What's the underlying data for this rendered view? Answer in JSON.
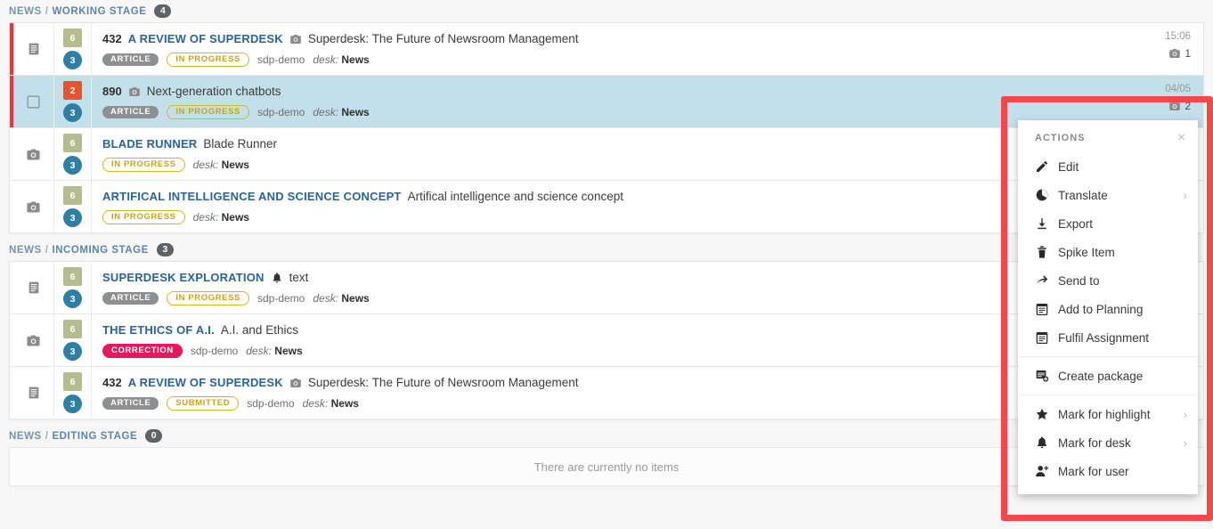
{
  "stages": [
    {
      "desk": "NEWS",
      "separator": "/",
      "name": "WORKING STAGE",
      "count": "4",
      "empty_text": "",
      "items": [
        {
          "type_icon": "document-icon",
          "priority_bar": true,
          "selected": false,
          "checkbox": false,
          "urgency": "6",
          "urgency_color": "#b5bd8f",
          "priority": "3",
          "priority_color": "#2f7ea3",
          "item_number": "432",
          "slugline": "A REVIEW OF SUPERDESK",
          "has_camera_icon": true,
          "has_bell_icon": false,
          "headline": "Superdesk: The Future of Newsroom Management",
          "type_pill": "ARTICLE",
          "state_pill": "IN PROGRESS",
          "state_class": "inprogress",
          "provider": "sdp-demo",
          "desk_label": "desk:",
          "desk_value": "News",
          "time": "15:06",
          "attachments": "1"
        },
        {
          "type_icon": "checkbox-icon",
          "priority_bar": true,
          "selected": true,
          "checkbox": true,
          "urgency": "2",
          "urgency_color": "#e8522e",
          "priority": "3",
          "priority_color": "#2f7ea3",
          "item_number": "890",
          "slugline": "",
          "has_camera_icon": true,
          "has_bell_icon": false,
          "headline": "Next-generation chatbots",
          "type_pill": "ARTICLE",
          "state_pill": "IN PROGRESS",
          "state_class": "inprogress",
          "provider": "sdp-demo",
          "desk_label": "desk:",
          "desk_value": "News",
          "time": "04/05",
          "attachments": "2"
        },
        {
          "type_icon": "camera-icon",
          "priority_bar": false,
          "selected": false,
          "checkbox": false,
          "urgency": "6",
          "urgency_color": "#b5bd8f",
          "priority": "3",
          "priority_color": "#2f7ea3",
          "item_number": "",
          "slugline": "BLADE RUNNER",
          "has_camera_icon": false,
          "has_bell_icon": false,
          "headline": "Blade Runner",
          "type_pill": "",
          "state_pill": "IN PROGRESS",
          "state_class": "inprogress",
          "provider": "",
          "desk_label": "desk:",
          "desk_value": "News",
          "time": "",
          "attachments": ""
        },
        {
          "type_icon": "camera-icon",
          "priority_bar": false,
          "selected": false,
          "checkbox": false,
          "urgency": "6",
          "urgency_color": "#b5bd8f",
          "priority": "3",
          "priority_color": "#2f7ea3",
          "item_number": "",
          "slugline": "ARTIFICAL INTELLIGENCE AND SCIENCE CONCEPT",
          "has_camera_icon": false,
          "has_bell_icon": false,
          "headline": "Artifical intelligence and science concept",
          "type_pill": "",
          "state_pill": "IN PROGRESS",
          "state_class": "inprogress",
          "provider": "",
          "desk_label": "desk:",
          "desk_value": "News",
          "time": "",
          "attachments": ""
        }
      ]
    },
    {
      "desk": "NEWS",
      "separator": "/",
      "name": "INCOMING STAGE",
      "count": "3",
      "empty_text": "",
      "items": [
        {
          "type_icon": "document-icon",
          "priority_bar": false,
          "selected": false,
          "checkbox": false,
          "urgency": "6",
          "urgency_color": "#b5bd8f",
          "priority": "3",
          "priority_color": "#2f7ea3",
          "item_number": "",
          "slugline": "SUPERDESK EXPLORATION",
          "has_camera_icon": false,
          "has_bell_icon": true,
          "headline": "text",
          "type_pill": "ARTICLE",
          "state_pill": "IN PROGRESS",
          "state_class": "inprogress",
          "provider": "sdp-demo",
          "desk_label": "desk:",
          "desk_value": "News",
          "time": "",
          "attachments": ""
        },
        {
          "type_icon": "camera-icon",
          "priority_bar": false,
          "selected": false,
          "checkbox": false,
          "urgency": "6",
          "urgency_color": "#b5bd8f",
          "priority": "3",
          "priority_color": "#2f7ea3",
          "item_number": "",
          "slugline": "THE ETHICS OF A.I.",
          "has_camera_icon": false,
          "has_bell_icon": false,
          "headline": "A.I. and Ethics",
          "type_pill": "",
          "state_pill": "CORRECTION",
          "state_class": "correction",
          "provider": "sdp-demo",
          "desk_label": "desk:",
          "desk_value": "News",
          "time": "",
          "attachments": ""
        },
        {
          "type_icon": "document-icon",
          "priority_bar": false,
          "selected": false,
          "checkbox": false,
          "urgency": "6",
          "urgency_color": "#b5bd8f",
          "priority": "3",
          "priority_color": "#2f7ea3",
          "item_number": "432",
          "slugline": "A REVIEW OF SUPERDESK",
          "has_camera_icon": true,
          "has_bell_icon": false,
          "headline": "Superdesk: The Future of Newsroom Management",
          "type_pill": "ARTICLE",
          "state_pill": "SUBMITTED",
          "state_class": "submitted",
          "provider": "sdp-demo",
          "desk_label": "desk:",
          "desk_value": "News",
          "time": "",
          "attachments": ""
        }
      ]
    },
    {
      "desk": "NEWS",
      "separator": "/",
      "name": "EDITING STAGE",
      "count": "0",
      "empty_text": "There are currently no items",
      "items": []
    }
  ],
  "actions_menu": {
    "title": "ACTIONS",
    "close_label": "×",
    "caret": "›",
    "groups": [
      {
        "items": [
          {
            "label": "Edit",
            "icon": "pencil-icon",
            "has_submenu": false
          },
          {
            "label": "Translate",
            "icon": "globe-icon",
            "has_submenu": true
          },
          {
            "label": "Export",
            "icon": "download-icon",
            "has_submenu": false
          },
          {
            "label": "Spike Item",
            "icon": "trash-icon",
            "has_submenu": false
          },
          {
            "label": "Send to",
            "icon": "send-arrow-icon",
            "has_submenu": false
          },
          {
            "label": "Add to Planning",
            "icon": "calendar-icon",
            "has_submenu": false
          },
          {
            "label": "Fulfil Assignment",
            "icon": "clipboard-icon",
            "has_submenu": false
          }
        ]
      },
      {
        "items": [
          {
            "label": "Create package",
            "icon": "create-package-icon",
            "has_submenu": false
          }
        ]
      },
      {
        "items": [
          {
            "label": "Mark for highlight",
            "icon": "star-icon",
            "has_submenu": true
          },
          {
            "label": "Mark for desk",
            "icon": "bell-icon",
            "has_submenu": true
          },
          {
            "label": "Mark for user",
            "icon": "user-add-icon",
            "has_submenu": false
          }
        ]
      }
    ]
  },
  "colors": {
    "accent_blue": "#2a6496",
    "stage_label": "#7494ad",
    "highlight_row": "#c3dfe9",
    "priority_red": "#e8373b",
    "annotation_red": "#ef4a45",
    "correction_pink": "#e8185d",
    "state_yellow": "#c8a415"
  }
}
